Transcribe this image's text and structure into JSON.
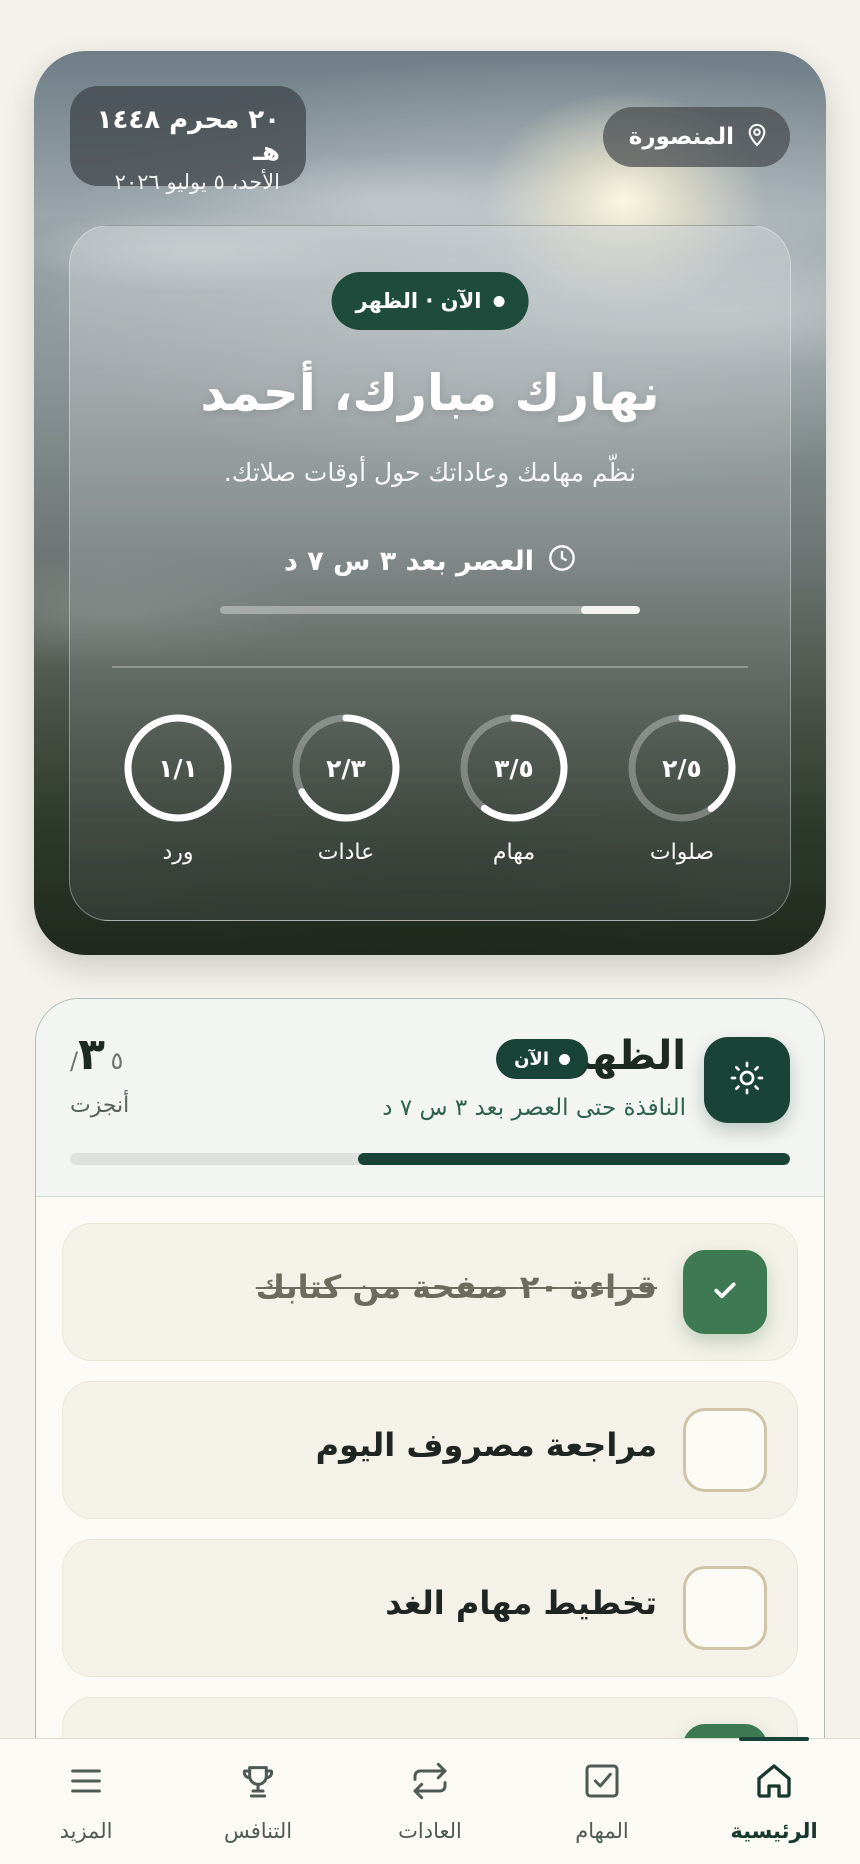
{
  "hero": {
    "hijri_date": "٢٠ محرم ١٤٤٨ هـ",
    "gregorian_date": "الأحد، ٥ يوليو ٢٠٢٦",
    "location": "المنصورة",
    "now_badge": "الآن · الظهر",
    "greeting": "نهارك مبارك، أحمد",
    "subtitle": "نظّم مهامك وعاداتك حول أوقات صلاتك.",
    "countdown": "العصر بعد ٣ س ٧ د",
    "countdown_progress": 0.14,
    "stats": [
      {
        "label": "صلوات",
        "value": "٢/٥",
        "progress": 0.4
      },
      {
        "label": "مهام",
        "value": "٣/٥",
        "progress": 0.6
      },
      {
        "label": "عادات",
        "value": "٢/٣",
        "progress": 0.67
      },
      {
        "label": "ورد",
        "value": "١/١",
        "progress": 1.0
      }
    ]
  },
  "prayer_card": {
    "prayer_name": "الظهر",
    "now_chip": "الآن",
    "window_text": "النافذة حتى العصر بعد ٣ س ٧ د",
    "done_count": "٣",
    "total_count": "/٥",
    "done_label": "أنجزت",
    "progress": 0.6,
    "tasks": [
      {
        "text": "قراءة ٢٠ صفحة من كتابك",
        "done": true
      },
      {
        "text": "مراجعة مصروف اليوم",
        "done": false
      },
      {
        "text": "تخطيط مهام الغد",
        "done": false
      },
      {
        "text": "",
        "done": true
      }
    ]
  },
  "nav": [
    {
      "label": "الرئيسية",
      "icon": "home-icon",
      "active": true
    },
    {
      "label": "المهام",
      "icon": "checkbox-icon",
      "active": false
    },
    {
      "label": "العادات",
      "icon": "repeat-icon",
      "active": false
    },
    {
      "label": "التنافس",
      "icon": "trophy-icon",
      "active": false
    },
    {
      "label": "المزيد",
      "icon": "menu-icon",
      "active": false
    }
  ],
  "colors": {
    "primary": "#1a4337",
    "success": "#3d7a53",
    "background": "#f3f1ea"
  }
}
